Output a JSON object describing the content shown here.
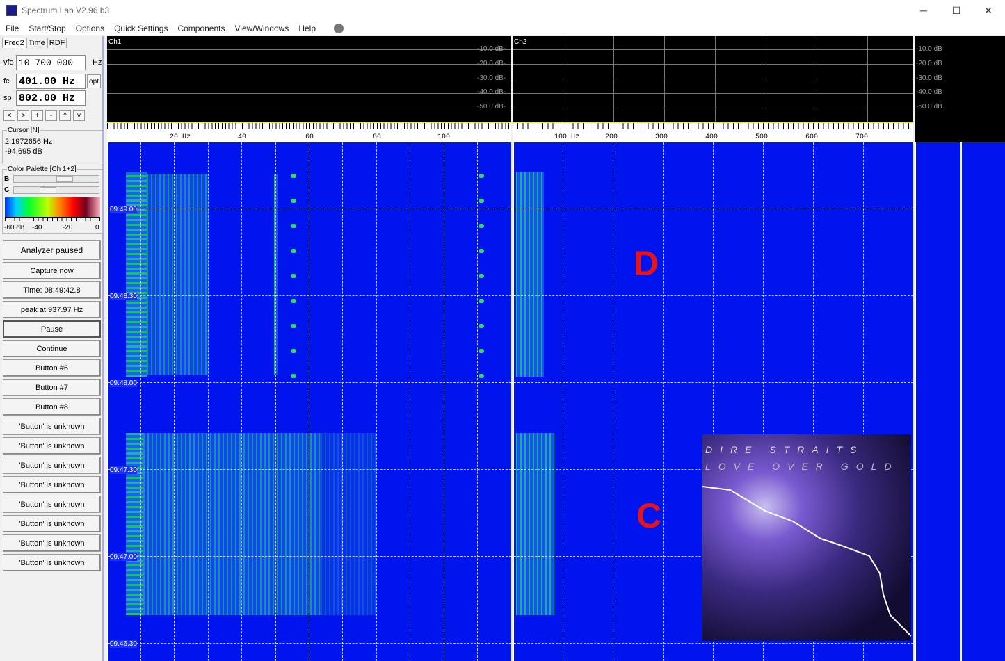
{
  "window": {
    "title": "Spectrum Lab V2.96 b3",
    "minimize": "─",
    "maximize": "☐",
    "close": "✕"
  },
  "menu": [
    "File",
    "Start/Stop",
    "Options",
    "Quick Settings",
    "Components",
    "View/Windows",
    "Help"
  ],
  "left": {
    "tabs": [
      "Freq2",
      "Time",
      "RDF"
    ],
    "vfo": {
      "label": "vfo",
      "value": "10 700 000",
      "unit": "Hz"
    },
    "fc": {
      "label": "fc",
      "value": "401.00 Hz",
      "opt": "opt"
    },
    "sp": {
      "label": "sp",
      "value": "802.00 Hz"
    },
    "nav": [
      "<",
      ">",
      "+",
      "-",
      "^",
      "v"
    ],
    "cursor": {
      "title": "Cursor [N]",
      "freq": "2.1972656 Hz",
      "level": "-94.695 dB"
    },
    "palette": {
      "title": "Color Palette [Ch 1+2]",
      "b": "B",
      "c": "C",
      "ticks": [
        "-60 dB",
        "-40",
        "-20",
        "0"
      ],
      "b_pos": 0.5,
      "c_pos": 0.3
    },
    "buttons": [
      "Analyzer paused",
      "Capture now",
      "Time:  08:49:42.8",
      "peak at 937.97 Hz",
      "Pause",
      "Continue",
      "Button #6",
      "Button #7",
      "Button #8",
      "'Button' is unknown",
      "'Button' is unknown",
      "'Button' is unknown",
      "'Button' is unknown",
      "'Button' is unknown",
      "'Button' is unknown",
      "'Button' is unknown",
      "'Button' is unknown"
    ]
  },
  "ch1": {
    "label": "Ch1",
    "db": [
      "-10.0 dB-",
      "-20.0 dB-",
      "-30.0 dB-",
      "-40.0 dB-",
      "-50.0 dB-"
    ],
    "freq": [
      "20  Hz",
      "40",
      "60",
      "80",
      "100"
    ]
  },
  "ch2": {
    "label": "Ch2",
    "db": [
      "-10.0 dB",
      "-20.0 dB",
      "-30.0 dB",
      "-40.0 dB",
      "-50.0 dB"
    ],
    "freq": [
      "100  Hz",
      "200",
      "300",
      "400",
      "500",
      "600",
      "700"
    ]
  },
  "times": [
    "09.49.00",
    "09.48.30",
    "09.48.00",
    "09.47.30",
    "09.47.00",
    "09.46.30"
  ],
  "overlay": {
    "top": "D",
    "bottom": "C"
  },
  "album": {
    "line1": "DIRE STRAITS",
    "line2": "LOVE OVER GOLD"
  }
}
